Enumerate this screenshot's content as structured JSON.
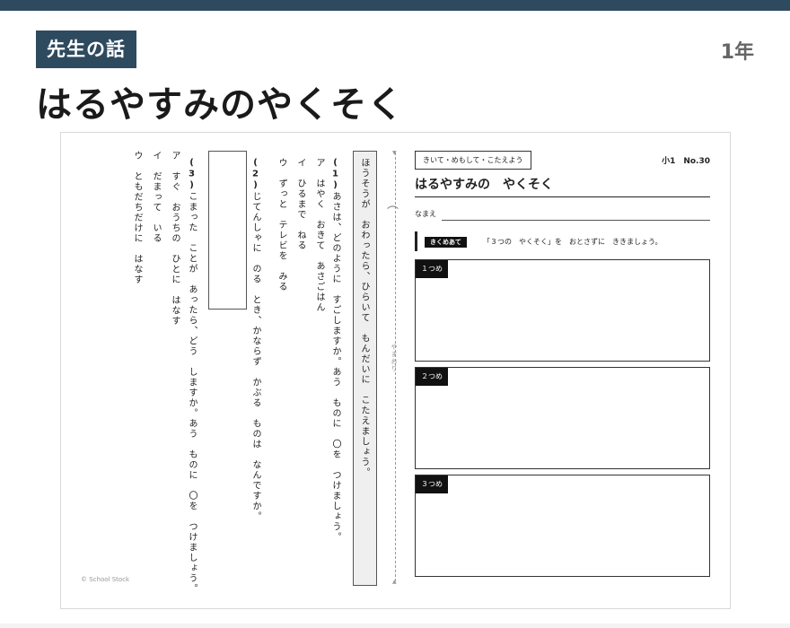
{
  "header": {
    "tag": "先生の話",
    "grade": "1年",
    "title": "はるやすみのやくそく"
  },
  "worksheet": {
    "instruction": "ほうそうが　おわったら、ひらいて　もんだいに　こたえましょう。",
    "q1": {
      "label": "(1)",
      "text": "あさは、どのように　すごしますか。あう　ものに　〇を　つけましょう。",
      "options": [
        {
          "mark": "ア",
          "text": "はやく　おきて　あさごはん"
        },
        {
          "mark": "イ",
          "text": "ひるまで　ねる"
        },
        {
          "mark": "ウ",
          "text": "ずっと　テレビを　みる"
        }
      ]
    },
    "q2": {
      "label": "(2)",
      "text": "じてんしゃに　のる　とき、かならず　かぶる　ものは　なんですか。"
    },
    "q3": {
      "label": "(3)",
      "text": "こまった　ことが　あったら、どう　しますか。あう　ものに　〇を　つけましょう。",
      "options": [
        {
          "mark": "ア",
          "text": "すぐ　おうちの　ひとに　はなす"
        },
        {
          "mark": "イ",
          "text": "だまって　いる"
        },
        {
          "mark": "ウ",
          "text": "ともだちだけに　はなす"
        }
      ]
    },
    "fold_label": "やまおり",
    "footer": "© School Stock",
    "right": {
      "tag": "きいて・めもして・こたえよう",
      "number": "小1　No.30",
      "title": "はるやすみの　やくそく",
      "name_label": "なまえ",
      "badge": "きくめあて",
      "ask": "「３つの　やくそく」を　おとさずに　ききましょう。",
      "boxes": [
        "１つめ",
        "２つめ",
        "３つめ"
      ]
    }
  }
}
